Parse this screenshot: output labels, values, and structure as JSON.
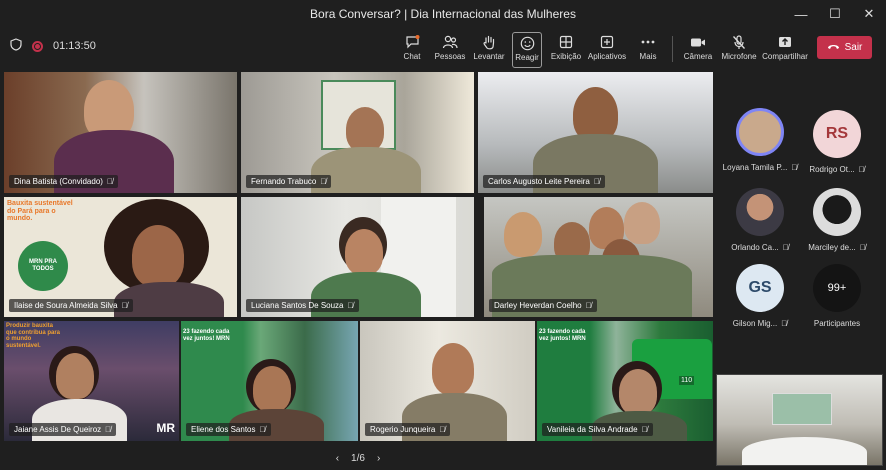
{
  "window": {
    "title": "Bora Conversar? | Dia Internacional das Mulheres",
    "minimize": "—",
    "maximize": "☐",
    "close": "✕"
  },
  "toolbar": {
    "timer": "01:13:50",
    "buttons": [
      {
        "label": "Chat",
        "icon": "chat-icon"
      },
      {
        "label": "Pessoas",
        "icon": "people-icon"
      },
      {
        "label": "Levantar",
        "icon": "raise-hand-icon"
      },
      {
        "label": "Reagir",
        "icon": "react-icon"
      },
      {
        "label": "Exibição",
        "icon": "view-icon"
      },
      {
        "label": "Aplicativos",
        "icon": "apps-icon"
      },
      {
        "label": "Mais",
        "icon": "more-icon"
      },
      {
        "label": "Câmera",
        "icon": "camera-icon"
      },
      {
        "label": "Microfone",
        "icon": "mic-off-icon"
      },
      {
        "label": "Compartilhar",
        "icon": "share-icon"
      }
    ],
    "leave_label": "Sair"
  },
  "tiles": [
    {
      "name": "Dina Batista (Convidado)",
      "bg": "#6b5a4c"
    },
    {
      "name": "Fernando Trabuco",
      "bg": "#8f8a80"
    },
    {
      "name": "Carlos Augusto Leite Pereira",
      "bg": "#b9bcbe"
    },
    {
      "name": "Ilaise de Soura Almeida Silva",
      "bg": "#e9e4d6"
    },
    {
      "name": "Luciana Santos De Souza",
      "bg": "#cfd2d2"
    },
    {
      "name": "Darley Heverdan Coelho",
      "bg": "#9e9a8e"
    },
    {
      "name": "Jaiane Assis De Queiroz",
      "bg": "#4b4a66"
    },
    {
      "name": "Eliene dos Santos",
      "bg": "#2f8a4d"
    },
    {
      "name": "Rogerio Junqueira",
      "bg": "#d6d3cb"
    },
    {
      "name": "Vanileia da Silva Andrade",
      "bg": "#1f7d3f"
    }
  ],
  "overlay_texts": {
    "bauxita1": "Bauxita sustentável do Pará para o mundo.",
    "mrn_logo": "MRN PRA TODOS",
    "bauxita2": "Produzir bauxita que contribua para o mundo sustentável.",
    "mrn_mark": "MR",
    "banner1": "23 fazendo cada vez juntos! MRN",
    "banner2": "23 fazendo cada vez juntos! MRN",
    "loco_num": "110"
  },
  "participants": [
    {
      "name": "Loyana Tamila P...",
      "initials": "",
      "color": "#c9a98c",
      "ring": true
    },
    {
      "name": "Rodrigo Ot...",
      "initials": "RS",
      "color": "#f2d6d8",
      "text_color": "#a4373a"
    },
    {
      "name": "Orlando Ca...",
      "initials": "",
      "color": "#8c7f74"
    },
    {
      "name": "Marciley de...",
      "initials": "",
      "color": "#dcdcdc"
    },
    {
      "name": "Gilson Mig...",
      "initials": "GS",
      "color": "#dde8f2",
      "text_color": "#2d4a6a"
    },
    {
      "name": "Participantes",
      "initials": "99+",
      "color": "#141414",
      "text_color": "#ffffff"
    }
  ],
  "pager": {
    "text": "1/6",
    "prev": "‹",
    "next": "›"
  }
}
